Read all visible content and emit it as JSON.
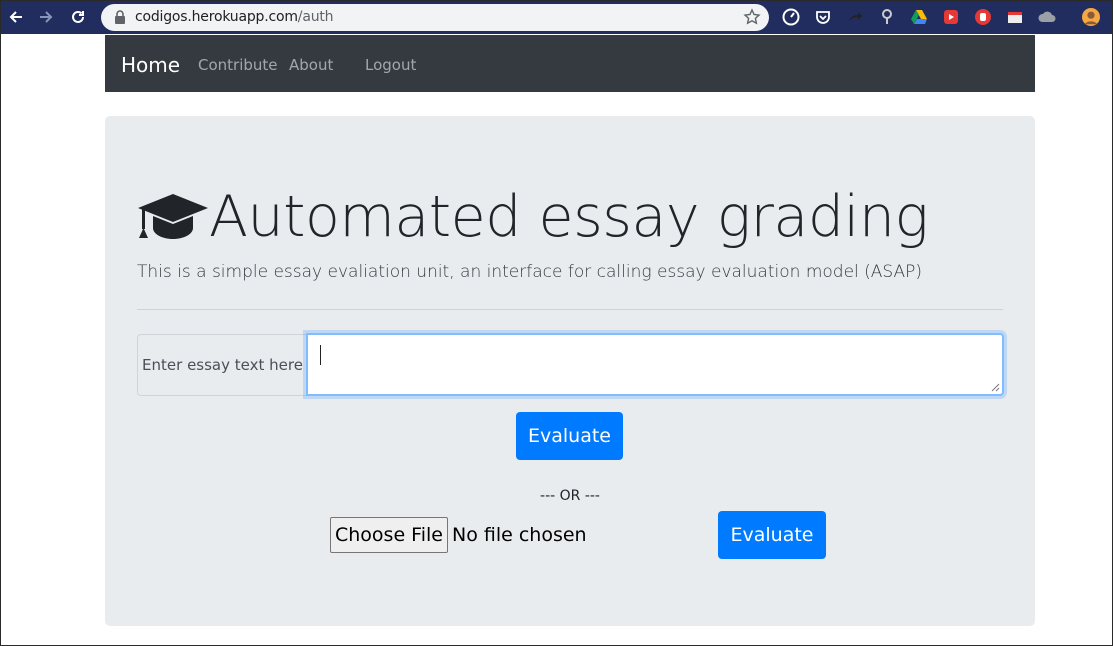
{
  "browser": {
    "url_host": "codigos.herokuapp.com",
    "url_path": "/auth"
  },
  "navbar": {
    "brand": "Home",
    "links": [
      "Contribute",
      "About",
      "Logout"
    ]
  },
  "hero": {
    "title": "Automated essay grading",
    "subtitle": "This is a simple essay evaliation unit, an interface for calling essay evaluation model (ASAP)"
  },
  "essay_form": {
    "label": "Enter essay text here",
    "value": "",
    "submit_label": "Evaluate"
  },
  "separator_text": "--- OR ---",
  "file_form": {
    "choose_label": "Choose File",
    "status": "No file chosen",
    "submit_label": "Evaluate"
  },
  "colors": {
    "navbar_bg": "#343a40",
    "jumbotron_bg": "#e9ecef",
    "primary": "#007bff",
    "chrome_bg": "#202d5e"
  }
}
